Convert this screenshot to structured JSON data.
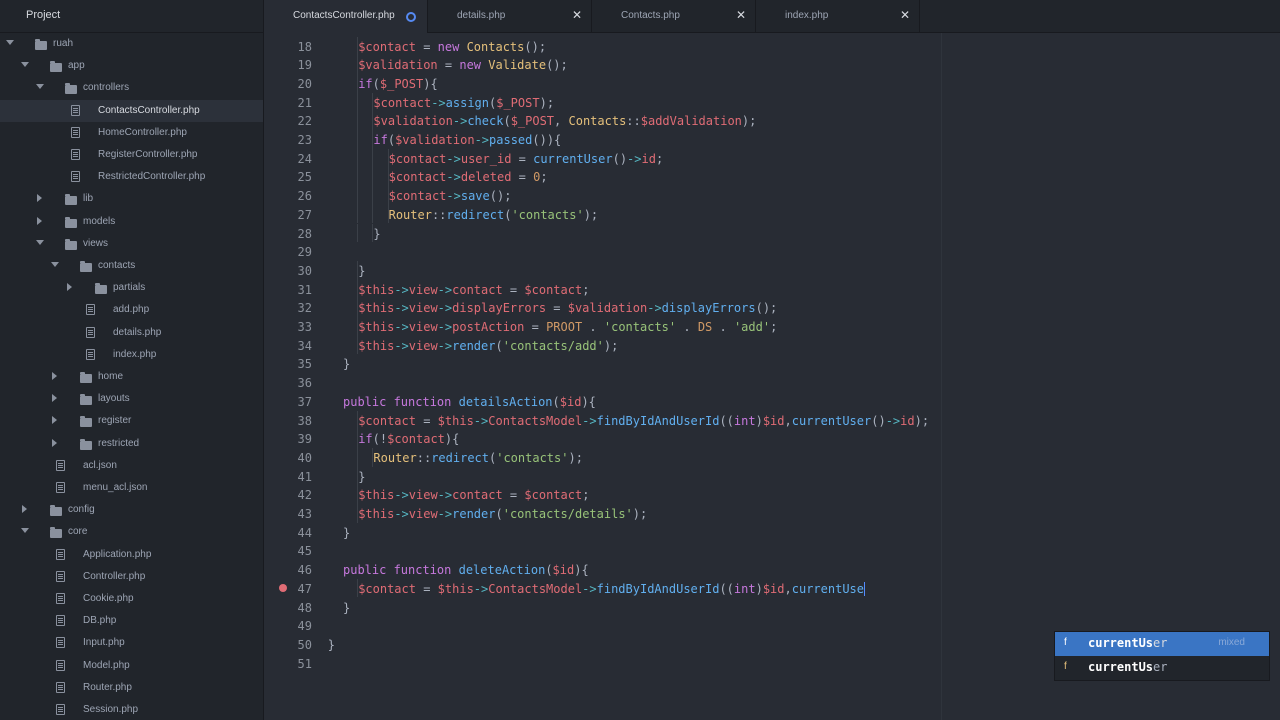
{
  "sidebar": {
    "title": "Project",
    "tree": [
      {
        "label": "ruah",
        "type": "folder",
        "open": true,
        "depth": 0
      },
      {
        "label": "app",
        "type": "folder",
        "open": true,
        "depth": 1
      },
      {
        "label": "controllers",
        "type": "folder",
        "open": true,
        "depth": 2
      },
      {
        "label": "ContactsController.php",
        "type": "file",
        "depth": 3,
        "selected": true
      },
      {
        "label": "HomeController.php",
        "type": "file",
        "depth": 3
      },
      {
        "label": "RegisterController.php",
        "type": "file",
        "depth": 3
      },
      {
        "label": "RestrictedController.php",
        "type": "file",
        "depth": 3
      },
      {
        "label": "lib",
        "type": "folder",
        "open": false,
        "depth": 2
      },
      {
        "label": "models",
        "type": "folder",
        "open": false,
        "depth": 2
      },
      {
        "label": "views",
        "type": "folder",
        "open": true,
        "depth": 2
      },
      {
        "label": "contacts",
        "type": "folder",
        "open": true,
        "depth": 3
      },
      {
        "label": "partials",
        "type": "folder",
        "open": false,
        "depth": 4
      },
      {
        "label": "add.php",
        "type": "file",
        "depth": 4
      },
      {
        "label": "details.php",
        "type": "file",
        "depth": 4
      },
      {
        "label": "index.php",
        "type": "file",
        "depth": 4
      },
      {
        "label": "home",
        "type": "folder",
        "open": false,
        "depth": 3
      },
      {
        "label": "layouts",
        "type": "folder",
        "open": false,
        "depth": 3
      },
      {
        "label": "register",
        "type": "folder",
        "open": false,
        "depth": 3
      },
      {
        "label": "restricted",
        "type": "folder",
        "open": false,
        "depth": 3
      },
      {
        "label": "acl.json",
        "type": "file",
        "depth": 2
      },
      {
        "label": "menu_acl.json",
        "type": "file",
        "depth": 2
      },
      {
        "label": "config",
        "type": "folder",
        "open": false,
        "depth": 1
      },
      {
        "label": "core",
        "type": "folder",
        "open": true,
        "depth": 1
      },
      {
        "label": "Application.php",
        "type": "file",
        "depth": 2
      },
      {
        "label": "Controller.php",
        "type": "file",
        "depth": 2
      },
      {
        "label": "Cookie.php",
        "type": "file",
        "depth": 2
      },
      {
        "label": "DB.php",
        "type": "file",
        "depth": 2
      },
      {
        "label": "Input.php",
        "type": "file",
        "depth": 2
      },
      {
        "label": "Model.php",
        "type": "file",
        "depth": 2
      },
      {
        "label": "Router.php",
        "type": "file",
        "depth": 2
      },
      {
        "label": "Session.php",
        "type": "file",
        "depth": 2
      }
    ]
  },
  "tabs": [
    {
      "label": "ContactsController.php",
      "active": true,
      "modified": true
    },
    {
      "label": "details.php",
      "active": false,
      "modified": false
    },
    {
      "label": "Contacts.php",
      "active": false,
      "modified": false
    },
    {
      "label": "index.php",
      "active": false,
      "modified": false
    }
  ],
  "tab_close_glyph": "✕",
  "editor": {
    "lines": [
      {
        "n": "18",
        "indent": 2,
        "tokens": [
          [
            "v",
            "$contact"
          ],
          [
            "p",
            " = "
          ],
          [
            "k",
            "new "
          ],
          [
            "c",
            "Contacts"
          ],
          [
            "p",
            "();"
          ]
        ]
      },
      {
        "n": "19",
        "indent": 2,
        "tokens": [
          [
            "v",
            "$validation"
          ],
          [
            "p",
            " = "
          ],
          [
            "k",
            "new "
          ],
          [
            "c",
            "Validate"
          ],
          [
            "p",
            "();"
          ]
        ]
      },
      {
        "n": "20",
        "indent": 2,
        "tokens": [
          [
            "k",
            "if"
          ],
          [
            "p",
            "("
          ],
          [
            "v",
            "$_POST"
          ],
          [
            "p",
            "){"
          ]
        ]
      },
      {
        "n": "21",
        "indent": 3,
        "tokens": [
          [
            "v",
            "$contact"
          ],
          [
            "o",
            "->"
          ],
          [
            "f",
            "assign"
          ],
          [
            "p",
            "("
          ],
          [
            "v",
            "$_POST"
          ],
          [
            "p",
            ");"
          ]
        ]
      },
      {
        "n": "22",
        "indent": 3,
        "tokens": [
          [
            "v",
            "$validation"
          ],
          [
            "o",
            "->"
          ],
          [
            "f",
            "check"
          ],
          [
            "p",
            "("
          ],
          [
            "v",
            "$_POST"
          ],
          [
            "p",
            ", "
          ],
          [
            "c",
            "Contacts"
          ],
          [
            "p",
            "::"
          ],
          [
            "v",
            "$addValidation"
          ],
          [
            "p",
            ");"
          ]
        ]
      },
      {
        "n": "23",
        "indent": 3,
        "tokens": [
          [
            "k",
            "if"
          ],
          [
            "p",
            "("
          ],
          [
            "v",
            "$validation"
          ],
          [
            "o",
            "->"
          ],
          [
            "f",
            "passed"
          ],
          [
            "p",
            "()){"
          ]
        ]
      },
      {
        "n": "24",
        "indent": 4,
        "tokens": [
          [
            "v",
            "$contact"
          ],
          [
            "o",
            "->"
          ],
          [
            "v",
            "user_id"
          ],
          [
            "p",
            " = "
          ],
          [
            "f",
            "currentUser"
          ],
          [
            "p",
            "()"
          ],
          [
            "o",
            "->"
          ],
          [
            "v",
            "id"
          ],
          [
            "p",
            ";"
          ]
        ]
      },
      {
        "n": "25",
        "indent": 4,
        "tokens": [
          [
            "v",
            "$contact"
          ],
          [
            "o",
            "->"
          ],
          [
            "v",
            "deleted"
          ],
          [
            "p",
            " = "
          ],
          [
            "n",
            "0"
          ],
          [
            "p",
            ";"
          ]
        ]
      },
      {
        "n": "26",
        "indent": 4,
        "tokens": [
          [
            "v",
            "$contact"
          ],
          [
            "o",
            "->"
          ],
          [
            "f",
            "save"
          ],
          [
            "p",
            "();"
          ]
        ]
      },
      {
        "n": "27",
        "indent": 4,
        "tokens": [
          [
            "c",
            "Router"
          ],
          [
            "p",
            "::"
          ],
          [
            "f",
            "redirect"
          ],
          [
            "p",
            "("
          ],
          [
            "s",
            "'contacts'"
          ],
          [
            "p",
            ");"
          ]
        ]
      },
      {
        "n": "28",
        "indent": 3,
        "tokens": [
          [
            "p",
            "}"
          ]
        ]
      },
      {
        "n": "29",
        "indent": 0,
        "tokens": []
      },
      {
        "n": "30",
        "indent": 2,
        "tokens": [
          [
            "p",
            "}"
          ]
        ]
      },
      {
        "n": "31",
        "indent": 2,
        "tokens": [
          [
            "v",
            "$this"
          ],
          [
            "o",
            "->"
          ],
          [
            "v",
            "view"
          ],
          [
            "o",
            "->"
          ],
          [
            "v",
            "contact"
          ],
          [
            "p",
            " = "
          ],
          [
            "v",
            "$contact"
          ],
          [
            "p",
            ";"
          ]
        ]
      },
      {
        "n": "32",
        "indent": 2,
        "tokens": [
          [
            "v",
            "$this"
          ],
          [
            "o",
            "->"
          ],
          [
            "v",
            "view"
          ],
          [
            "o",
            "->"
          ],
          [
            "v",
            "displayErrors"
          ],
          [
            "p",
            " = "
          ],
          [
            "v",
            "$validation"
          ],
          [
            "o",
            "->"
          ],
          [
            "f",
            "displayErrors"
          ],
          [
            "p",
            "();"
          ]
        ]
      },
      {
        "n": "33",
        "indent": 2,
        "tokens": [
          [
            "v",
            "$this"
          ],
          [
            "o",
            "->"
          ],
          [
            "v",
            "view"
          ],
          [
            "o",
            "->"
          ],
          [
            "v",
            "postAction"
          ],
          [
            "p",
            " = "
          ],
          [
            "n",
            "PROOT"
          ],
          [
            "p",
            " . "
          ],
          [
            "s",
            "'contacts'"
          ],
          [
            "p",
            " . "
          ],
          [
            "n",
            "DS"
          ],
          [
            "p",
            " . "
          ],
          [
            "s",
            "'add'"
          ],
          [
            "p",
            ";"
          ]
        ]
      },
      {
        "n": "34",
        "indent": 2,
        "tokens": [
          [
            "v",
            "$this"
          ],
          [
            "o",
            "->"
          ],
          [
            "v",
            "view"
          ],
          [
            "o",
            "->"
          ],
          [
            "f",
            "render"
          ],
          [
            "p",
            "("
          ],
          [
            "s",
            "'contacts/add'"
          ],
          [
            "p",
            ");"
          ]
        ]
      },
      {
        "n": "35",
        "indent": 1,
        "tokens": [
          [
            "p",
            "}"
          ]
        ]
      },
      {
        "n": "36",
        "indent": 0,
        "tokens": []
      },
      {
        "n": "37",
        "indent": 1,
        "tokens": [
          [
            "k",
            "public "
          ],
          [
            "k",
            "function "
          ],
          [
            "f",
            "detailsAction"
          ],
          [
            "p",
            "("
          ],
          [
            "v",
            "$id"
          ],
          [
            "p",
            "){"
          ]
        ]
      },
      {
        "n": "38",
        "indent": 2,
        "tokens": [
          [
            "v",
            "$contact"
          ],
          [
            "p",
            " = "
          ],
          [
            "v",
            "$this"
          ],
          [
            "o",
            "->"
          ],
          [
            "v",
            "ContactsModel"
          ],
          [
            "o",
            "->"
          ],
          [
            "f",
            "findByIdAndUserId"
          ],
          [
            "p",
            "(("
          ],
          [
            "k",
            "int"
          ],
          [
            "p",
            ")"
          ],
          [
            "v",
            "$id"
          ],
          [
            "p",
            ","
          ],
          [
            "f",
            "currentUser"
          ],
          [
            "p",
            "()"
          ],
          [
            "o",
            "->"
          ],
          [
            "v",
            "id"
          ],
          [
            "p",
            ");"
          ]
        ]
      },
      {
        "n": "39",
        "indent": 2,
        "tokens": [
          [
            "k",
            "if"
          ],
          [
            "p",
            "(!"
          ],
          [
            "v",
            "$contact"
          ],
          [
            "p",
            "){"
          ]
        ]
      },
      {
        "n": "40",
        "indent": 3,
        "tokens": [
          [
            "c",
            "Router"
          ],
          [
            "p",
            "::"
          ],
          [
            "f",
            "redirect"
          ],
          [
            "p",
            "("
          ],
          [
            "s",
            "'contacts'"
          ],
          [
            "p",
            ");"
          ]
        ]
      },
      {
        "n": "41",
        "indent": 2,
        "tokens": [
          [
            "p",
            "}"
          ]
        ]
      },
      {
        "n": "42",
        "indent": 2,
        "tokens": [
          [
            "v",
            "$this"
          ],
          [
            "o",
            "->"
          ],
          [
            "v",
            "view"
          ],
          [
            "o",
            "->"
          ],
          [
            "v",
            "contact"
          ],
          [
            "p",
            " = "
          ],
          [
            "v",
            "$contact"
          ],
          [
            "p",
            ";"
          ]
        ]
      },
      {
        "n": "43",
        "indent": 2,
        "tokens": [
          [
            "v",
            "$this"
          ],
          [
            "o",
            "->"
          ],
          [
            "v",
            "view"
          ],
          [
            "o",
            "->"
          ],
          [
            "f",
            "render"
          ],
          [
            "p",
            "("
          ],
          [
            "s",
            "'contacts/details'"
          ],
          [
            "p",
            ");"
          ]
        ]
      },
      {
        "n": "44",
        "indent": 1,
        "tokens": [
          [
            "p",
            "}"
          ]
        ]
      },
      {
        "n": "45",
        "indent": 0,
        "tokens": []
      },
      {
        "n": "46",
        "indent": 1,
        "tokens": [
          [
            "k",
            "public "
          ],
          [
            "k",
            "function "
          ],
          [
            "f",
            "deleteAction"
          ],
          [
            "p",
            "("
          ],
          [
            "v",
            "$id"
          ],
          [
            "p",
            "){"
          ]
        ]
      },
      {
        "n": "47",
        "indent": 2,
        "breakpoint": true,
        "cursor": true,
        "tokens": [
          [
            "v",
            "$contact"
          ],
          [
            "p",
            " = "
          ],
          [
            "v",
            "$this"
          ],
          [
            "o",
            "->"
          ],
          [
            "v",
            "ContactsModel"
          ],
          [
            "o",
            "->"
          ],
          [
            "f",
            "findByIdAndUserId"
          ],
          [
            "p",
            "(("
          ],
          [
            "k",
            "int"
          ],
          [
            "p",
            ")"
          ],
          [
            "v",
            "$id"
          ],
          [
            "p",
            ","
          ],
          [
            "f",
            "currentUse"
          ]
        ]
      },
      {
        "n": "48",
        "indent": 1,
        "tokens": [
          [
            "p",
            "}"
          ]
        ]
      },
      {
        "n": "49",
        "indent": 0,
        "tokens": []
      },
      {
        "n": "50",
        "indent": 0,
        "tokens": [
          [
            "p",
            "}"
          ]
        ]
      },
      {
        "n": "51",
        "indent": 0,
        "tokens": []
      }
    ]
  },
  "autocomplete": {
    "items": [
      {
        "type": "f",
        "match": "currentUs",
        "rest": "er",
        "right": "mixed",
        "selected": true
      },
      {
        "type": "f",
        "match": "currentUs",
        "rest": "er",
        "right": "",
        "selected": false
      }
    ]
  },
  "colors": {
    "background": "#282c34",
    "sidebar": "#21252b",
    "selection": "#3a75c4",
    "variable": "#e06c75",
    "keyword": "#c678dd",
    "function": "#61afef",
    "string": "#98c379",
    "class": "#e5c07b"
  }
}
